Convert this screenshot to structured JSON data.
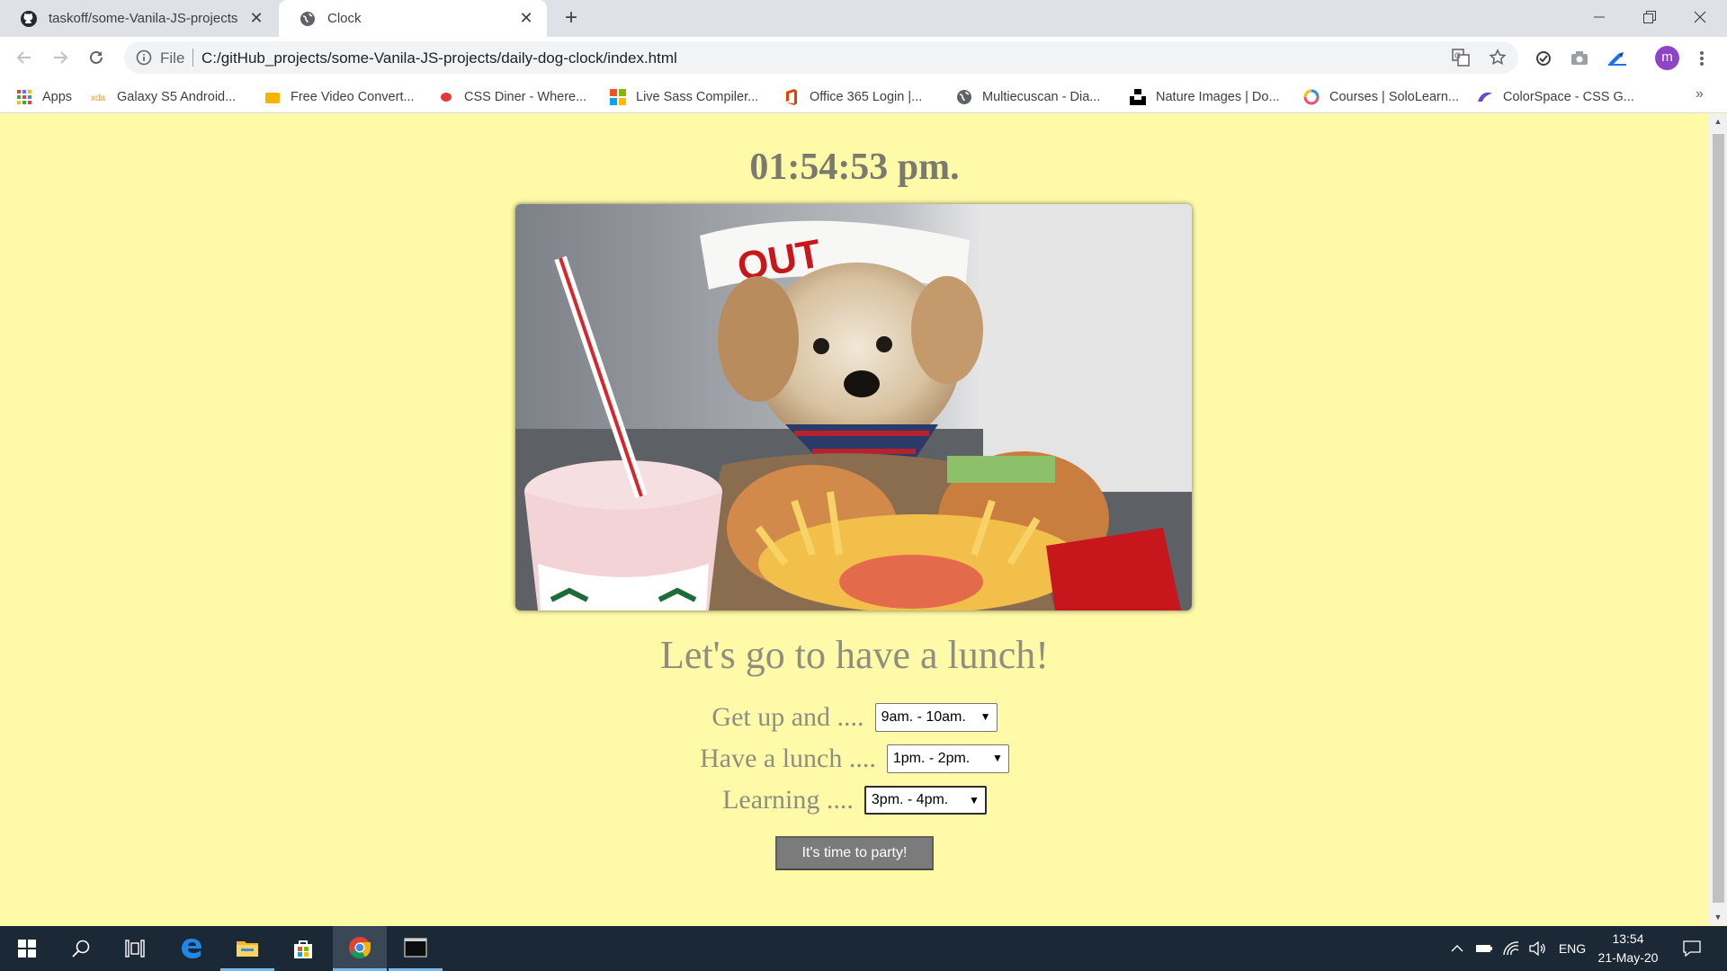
{
  "browser": {
    "tabs": [
      {
        "title": "taskoff/some-Vanila-JS-projects",
        "icon": "github-icon"
      },
      {
        "title": "Clock",
        "icon": "globe-icon"
      }
    ],
    "new_tab_label": "+",
    "address": {
      "scheme_label": "File",
      "url": "C:/gitHub_projects/some-Vanila-JS-projects/daily-dog-clock/index.html"
    },
    "profile_initial": "m",
    "bookmarks": [
      {
        "label": "Apps",
        "icon": "apps-grid-icon"
      },
      {
        "label": "Galaxy S5 Android...",
        "icon": "xda-icon"
      },
      {
        "label": "Free Video Convert...",
        "icon": "video-converter-icon"
      },
      {
        "label": "CSS Diner - Where...",
        "icon": "css-diner-icon"
      },
      {
        "label": "Live Sass Compiler...",
        "icon": "microsoft-icon"
      },
      {
        "label": "Office 365 Login |...",
        "icon": "office-icon"
      },
      {
        "label": "Multiecuscan - Dia...",
        "icon": "globe-icon"
      },
      {
        "label": "Nature Images | Do...",
        "icon": "unsplash-icon"
      },
      {
        "label": "Courses | SoloLearn...",
        "icon": "sololearn-icon"
      },
      {
        "label": "ColorSpace - CSS G...",
        "icon": "colorspace-icon"
      }
    ],
    "more_bookmarks": "»"
  },
  "page": {
    "clock": "01:54:53 pm.",
    "photo": {
      "icon": "dog-lunch-photo"
    },
    "headline": "Let's go to have a lunch!",
    "selectors": [
      {
        "label": "Get up and ....",
        "value": "9am. - 10am."
      },
      {
        "label": "Have a lunch ....",
        "value": "1pm. - 2pm."
      },
      {
        "label": "Learning ....",
        "value": "3pm. - 4pm."
      }
    ],
    "party_button": "It's time to party!",
    "background_color": "#fefaa8"
  },
  "taskbar": {
    "language": "ENG",
    "time": "13:54",
    "date": "21-May-20"
  }
}
